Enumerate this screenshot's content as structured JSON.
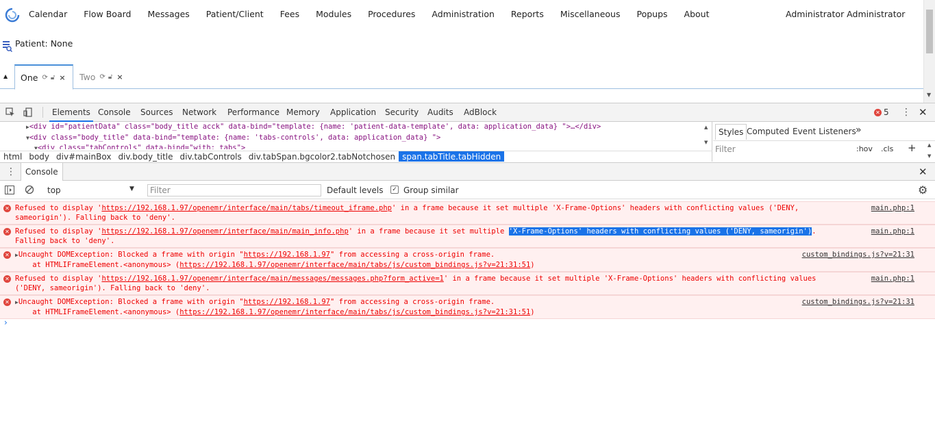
{
  "menu": [
    "Calendar",
    "Flow Board",
    "Messages",
    "Patient/Client",
    "Fees",
    "Modules",
    "Procedures",
    "Administration",
    "Reports",
    "Miscellaneous",
    "Popups",
    "About"
  ],
  "user": "Administrator Administrator",
  "patient_label": "Patient: None",
  "tabs": [
    {
      "label": "One"
    },
    {
      "label": "Two"
    }
  ],
  "devtools": {
    "tabs": [
      "Elements",
      "Console",
      "Sources",
      "Network",
      "Performance",
      "Memory",
      "Application",
      "Security",
      "Audits",
      "AdBlock"
    ],
    "error_count": "5",
    "elements_lines": [
      "<div id=\"patientData\" class=\"body_title acck\" data-bind=\"template: {name: 'patient-data-template', data: application_data} \">…</div>",
      "<div class=\"body_title\" data-bind=\"template: {name: 'tabs-controls', data: application_data} \">",
      "<div class=\"tabControls\" data-bind=\"with: tabs\">"
    ],
    "breadcrumb": [
      "html",
      "body",
      "div#mainBox",
      "div.body_title",
      "div.tabControls",
      "div.tabSpan.bgcolor2.tabNotchosen",
      "span.tabTitle.tabHidden"
    ],
    "styles_tabs": [
      "Styles",
      "Computed",
      "Event Listeners"
    ],
    "styles_filter": "Filter",
    "hov": ":hov",
    "cls": ".cls",
    "drawer_tab": "Console",
    "context": "top",
    "filter_placeholder": "Filter",
    "levels": "Default levels",
    "group_similar": "Group similar"
  },
  "messages": [
    {
      "pre": "Refused to display '",
      "link": "https://192.168.1.97/openemr/interface/main/tabs/timeout_iframe.php",
      "post": "' in a frame because it set multiple 'X-Frame-Options' headers with conflicting values ('DENY,\nsameorigin'). Falling back to 'deny'.",
      "source": "main.php:1"
    },
    {
      "pre": "Refused to display '",
      "link": "https://192.168.1.97/openemr/interface/main/main_info.php",
      "mid": "' in a frame because it set multiple ",
      "highlight": "'X-Frame-Options' headers with conflicting values ('DENY, sameorigin')",
      "post": ".\nFalling back to 'deny'.",
      "source": "main.php:1"
    },
    {
      "pre": "Uncaught DOMException: Blocked a frame with origin \"",
      "link": "https://192.168.1.97",
      "post": "\" from accessing a cross-origin frame.",
      "line2_pre": "    at HTMLIFrameElement.<anonymous> (",
      "line2_link": "https://192.168.1.97/openemr/interface/main/tabs/js/custom_bindings.js?v=21:31:51",
      "line2_post": ")",
      "source": "custom_bindings.js?v=21:31"
    },
    {
      "pre": "Refused to display '",
      "link": "https://192.168.1.97/openemr/interface/main/messages/messages.php?form_active=1",
      "post": "' in a frame because it set multiple 'X-Frame-Options' headers with conflicting values\n('DENY, sameorigin'). Falling back to 'deny'.",
      "source": "main.php:1"
    },
    {
      "pre": "Uncaught DOMException: Blocked a frame with origin \"",
      "link": "https://192.168.1.97",
      "post": "\" from accessing a cross-origin frame.",
      "line2_pre": "    at HTMLIFrameElement.<anonymous> (",
      "line2_link": "https://192.168.1.97/openemr/interface/main/tabs/js/custom_bindings.js?v=21:31:51",
      "line2_post": ")",
      "source": "custom_bindings.js?v=21:31"
    }
  ]
}
